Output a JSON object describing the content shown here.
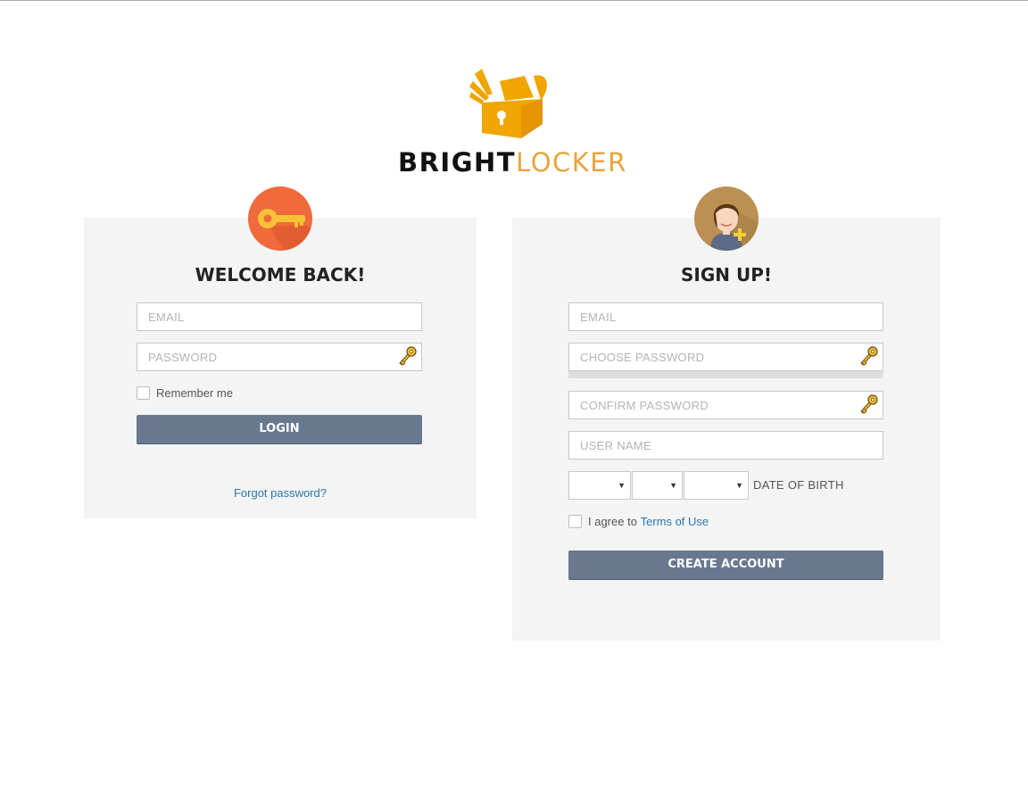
{
  "brand": {
    "part1": "BRIGHT",
    "part2": "LOCKER"
  },
  "login": {
    "heading": "WELCOME BACK!",
    "badge_icon": "key-icon",
    "email_placeholder": "EMAIL",
    "password_placeholder": "PASSWORD",
    "remember_label": "Remember me",
    "remember_checked": false,
    "login_label": "LOGIN",
    "forgot_label": "Forgot password?"
  },
  "signup": {
    "heading": "SIGN UP!",
    "badge_icon": "add-user-icon",
    "email_placeholder": "EMAIL",
    "choose_password_placeholder": "CHOOSE PASSWORD",
    "confirm_password_placeholder": "CONFIRM PASSWORD",
    "username_placeholder": "USER NAME",
    "dob_label": "DATE OF BIRTH",
    "dob_selects": [
      {
        "name": "dob-month-select",
        "value": ""
      },
      {
        "name": "dob-day-select",
        "value": ""
      },
      {
        "name": "dob-year-select",
        "value": ""
      }
    ],
    "agree_prefix": "I agree to",
    "terms_label": "Terms of Use",
    "agree_checked": false,
    "create_label": "CREATE ACCOUNT"
  },
  "colors": {
    "accent_orange": "#f0a500",
    "key_badge": "#f06a3c",
    "button": "#68788f",
    "link": "#2a77a8",
    "panel_bg": "#f4f4f5"
  }
}
